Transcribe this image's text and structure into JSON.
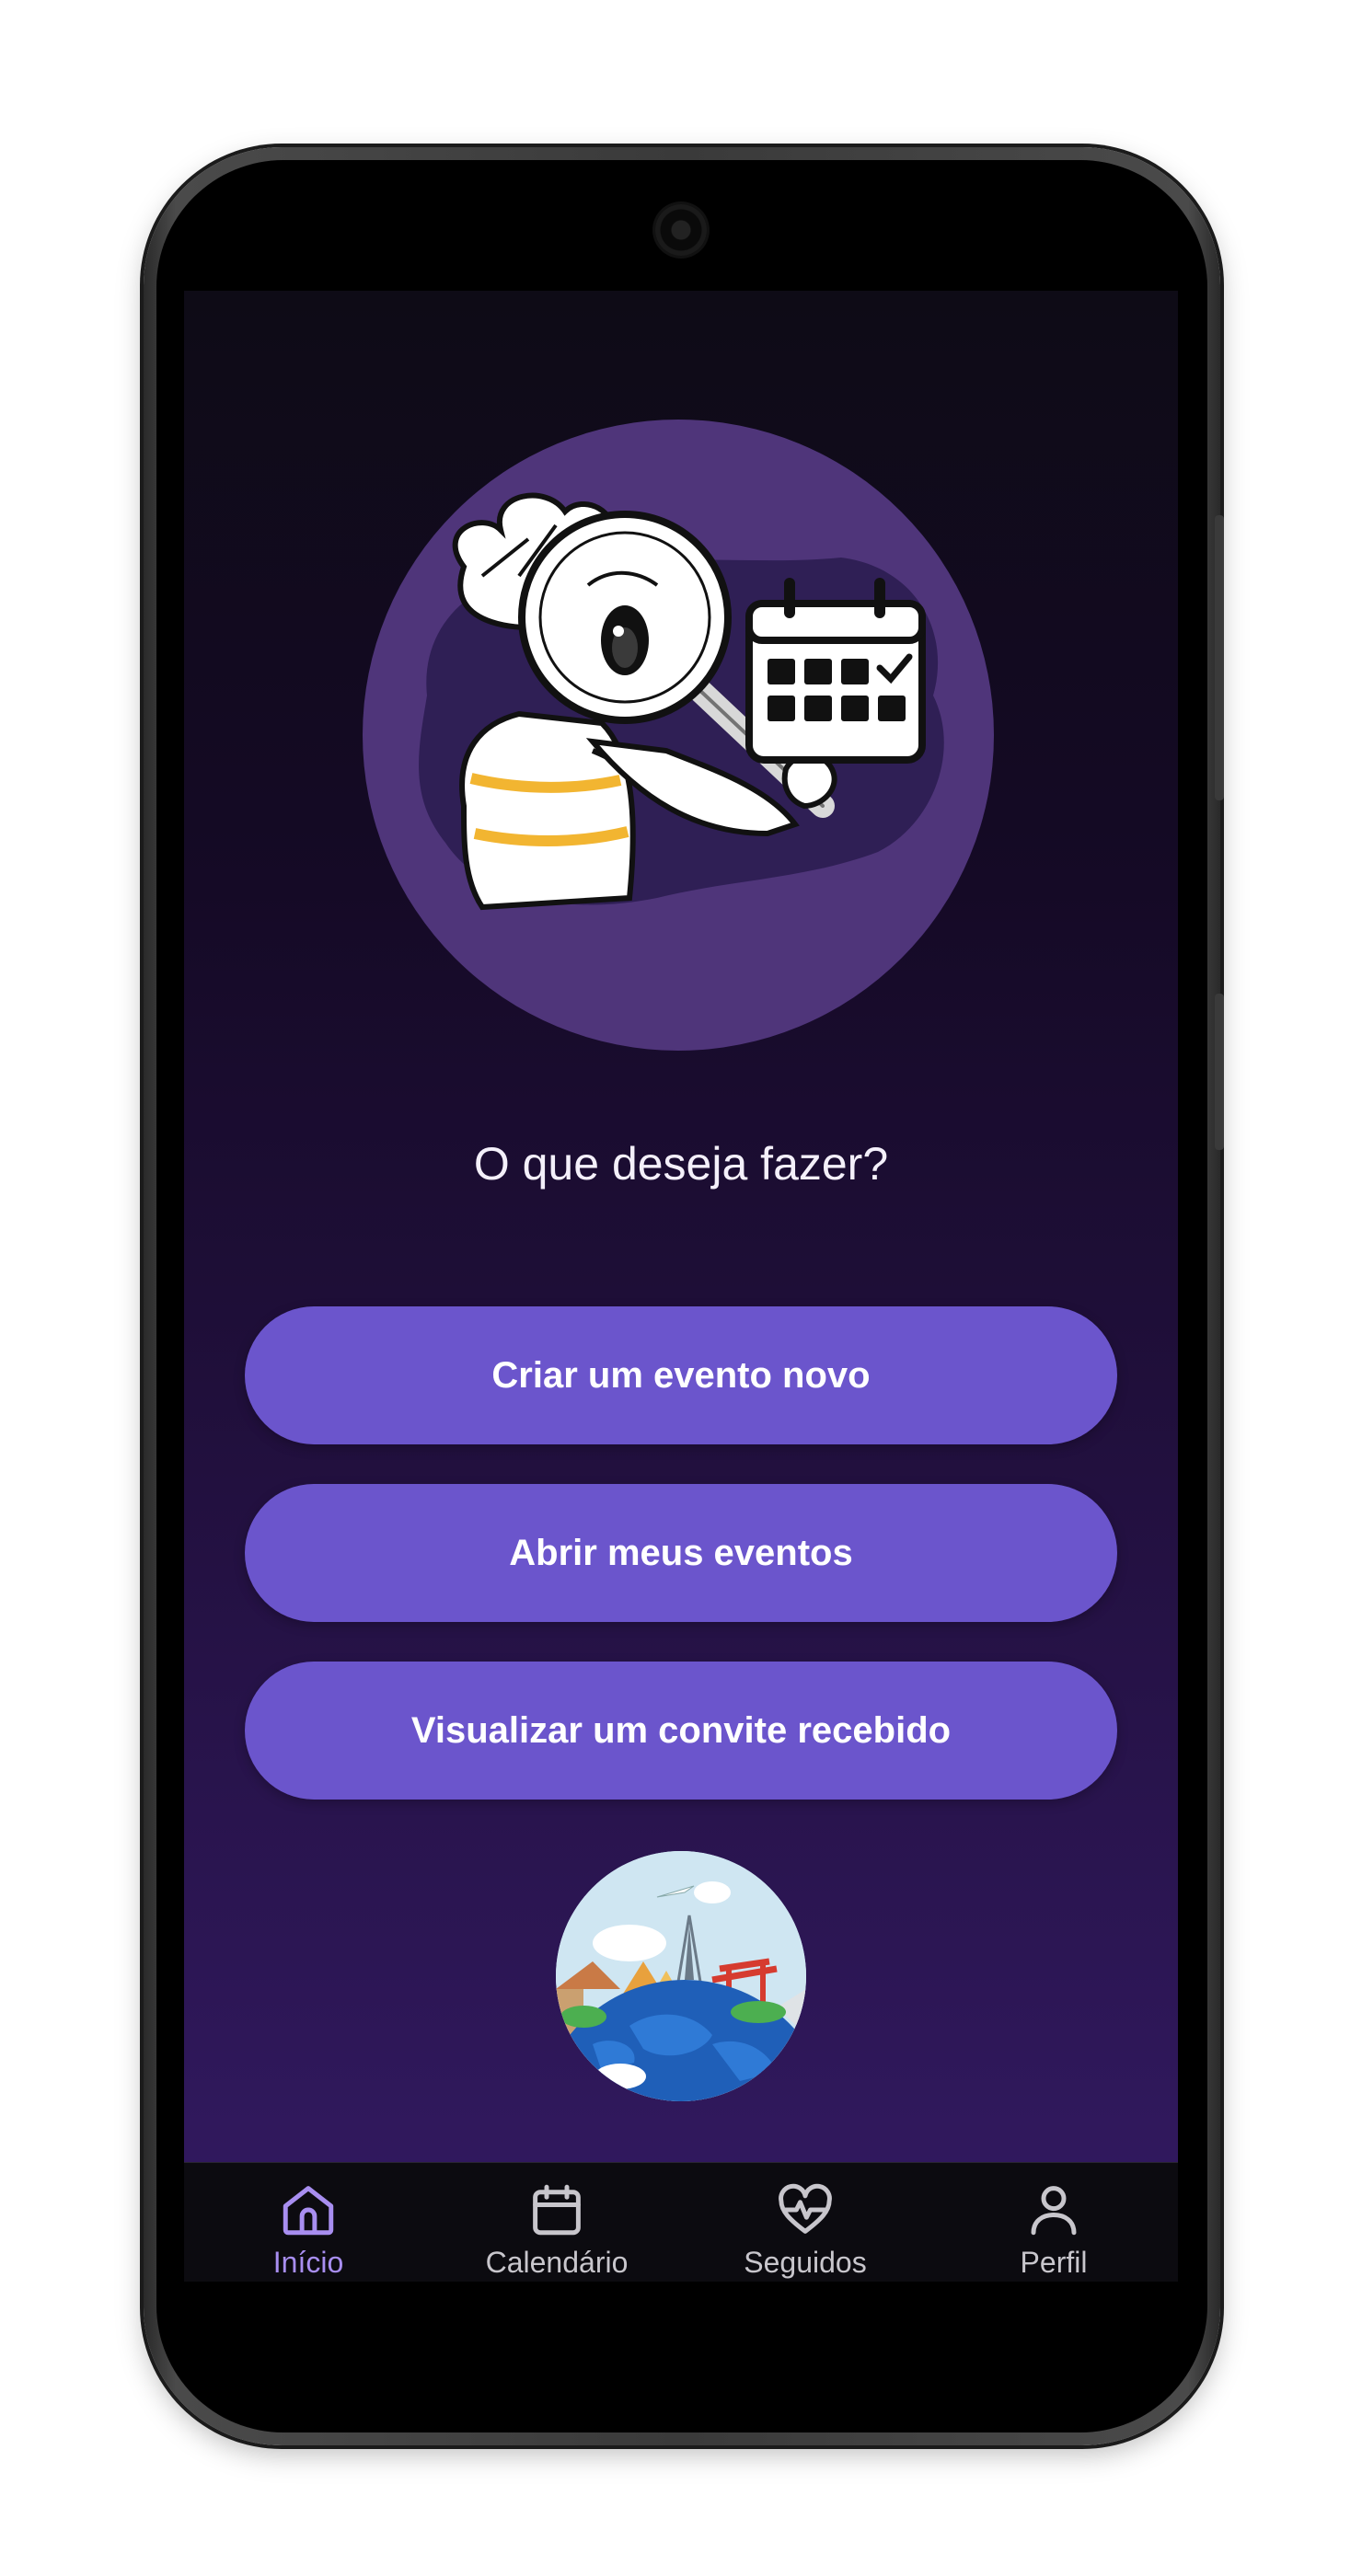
{
  "prompt": {
    "question": "O que deseja fazer?"
  },
  "actions": {
    "create_event": "Criar um evento novo",
    "open_events": "Abrir meus eventos",
    "view_invite": "Visualizar um convite recebido"
  },
  "navigation": {
    "items": [
      {
        "label": "Início",
        "icon": "home-icon",
        "active": true
      },
      {
        "label": "Calendário",
        "icon": "calendar-icon",
        "active": false
      },
      {
        "label": "Seguidos",
        "icon": "heart-pulse-icon",
        "active": false
      },
      {
        "label": "Perfil",
        "icon": "person-icon",
        "active": false
      }
    ]
  },
  "colors": {
    "accent": "#6b55cc",
    "nav_active": "#a88ef0",
    "hero_circle": "#4f357a"
  }
}
